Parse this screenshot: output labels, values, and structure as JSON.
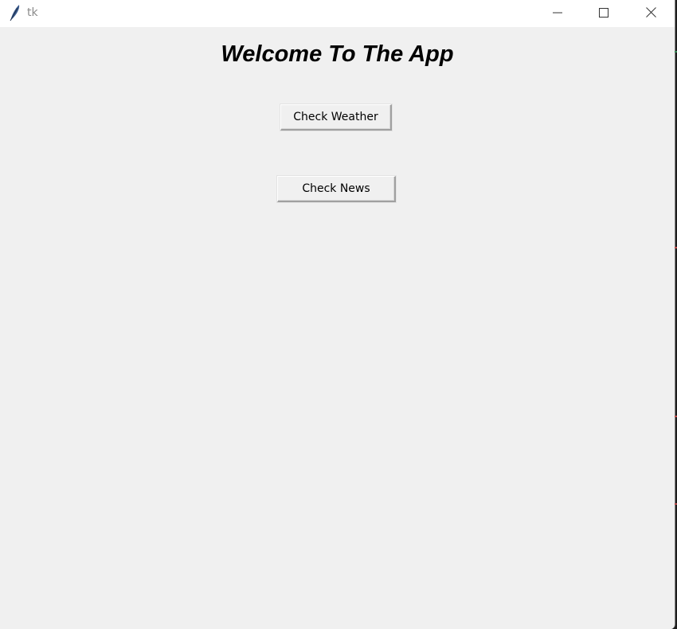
{
  "window": {
    "title": "tk",
    "controls": {
      "minimize": "minimize-icon",
      "maximize": "maximize-icon",
      "close": "close-icon"
    }
  },
  "main": {
    "heading": "Welcome To The App",
    "buttons": {
      "weather": "Check Weather",
      "news": "Check News"
    }
  },
  "colors": {
    "background": "#f0f0f0",
    "titlebar": "#ffffff",
    "title_text": "#8a8a8a",
    "heading_text": "#000000"
  }
}
